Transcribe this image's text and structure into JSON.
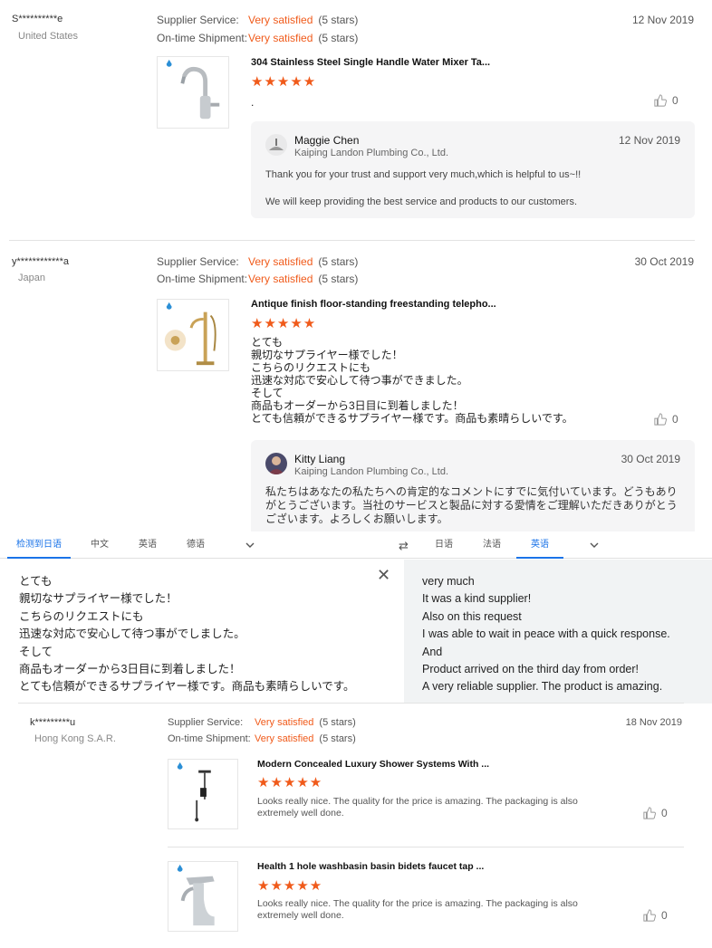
{
  "reviews": [
    {
      "buyer": "S**********e",
      "country": "United States",
      "supplier_service_label": "Supplier Service:",
      "supplier_service_value": "Very satisfied",
      "supplier_service_count": "(5 stars)",
      "shipment_label": "On-time Shipment:",
      "shipment_value": "Very satisfied",
      "shipment_count": "(5 stars)",
      "date": "12 Nov 2019",
      "product_title": "304 Stainless Steel Single Handle Water Mixer Ta...",
      "stars": "★★★★★",
      "text": ".",
      "likes": "0",
      "reply": {
        "name": "Maggie Chen",
        "company": "Kaiping Landon Plumbing Co., Ltd.",
        "date": "12 Nov 2019",
        "text": "Thank you for your trust and support very much,which is helpful to us~!!\n\nWe will keep providing the best service and products to our customers."
      }
    },
    {
      "buyer": "y************a",
      "country": "Japan",
      "supplier_service_label": "Supplier Service:",
      "supplier_service_value": "Very satisfied",
      "supplier_service_count": "(5 stars)",
      "shipment_label": "On-time Shipment:",
      "shipment_value": "Very satisfied",
      "shipment_count": "(5 stars)",
      "date": "30 Oct 2019",
      "product_title": "Antique finish floor-standing freestanding telepho...",
      "stars": "★★★★★",
      "text": "とても\n親切なサプライヤー様でした！\nこちらのリクエストにも\n迅速な対応で安心して待つ事ができました。\nそして\n商品もオーダーから3日目に到着しました！\nとても信頼ができるサプライヤー様です。商品も素晴らしいです。",
      "likes": "0",
      "reply": {
        "name": "Kitty Liang",
        "company": "Kaiping Landon Plumbing Co., Ltd.",
        "date": "30 Oct 2019",
        "text": "私たちはあなたの私たちへの肯定的なコメントにすでに気付いています。どうもあり\nがとうございます。当社のサービスと製品に対する愛情をご理解いただきありがとう\nございます。よろしくお願いします。"
      }
    },
    {
      "buyer": "k*********u",
      "country": "Hong Kong S.A.R.",
      "supplier_service_label": "Supplier Service:",
      "supplier_service_value": "Very satisfied",
      "supplier_service_count": "(5 stars)",
      "shipment_label": "On-time Shipment:",
      "shipment_value": "Very satisfied",
      "shipment_count": "(5 stars)",
      "date": "18 Nov 2019",
      "products": [
        {
          "title": "Modern Concealed Luxury Shower Systems With ...",
          "stars": "★★★★★",
          "text": "Looks really nice. The quality for the price is amazing. The packaging is also\nextremely well done.",
          "likes": "0"
        },
        {
          "title": "Health 1 hole washbasin basin bidets faucet tap ...",
          "stars": "★★★★★",
          "text": "Looks really nice. The quality for the price is amazing. The packaging is also\nextremely well done.",
          "likes": "0"
        }
      ]
    }
  ],
  "translate": {
    "source_tabs": [
      "检测到日语",
      "中文",
      "英语",
      "德语"
    ],
    "target_tabs": [
      "日语",
      "法语",
      "英语"
    ],
    "source_text": "とても\n親切なサプライヤー様でした！\nこちらのリクエストにも\n迅速な対応で安心して待つ事がでしました。\nそして\n商品もオーダーから3日目に到着しました！\nとても信頼ができるサプライヤー様です。商品も素晴らしいです。",
    "target_text": "very much\nIt was a kind supplier!\nAlso on this request\nI was able to wait in peace with a quick response.\nAnd\nProduct arrived on the third day from order!\nA very reliable supplier. The product is amazing."
  },
  "colors": {
    "accent": "#f05a1a",
    "translate_active": "#1a73e8",
    "reply_bg": "#f5f5f6"
  }
}
